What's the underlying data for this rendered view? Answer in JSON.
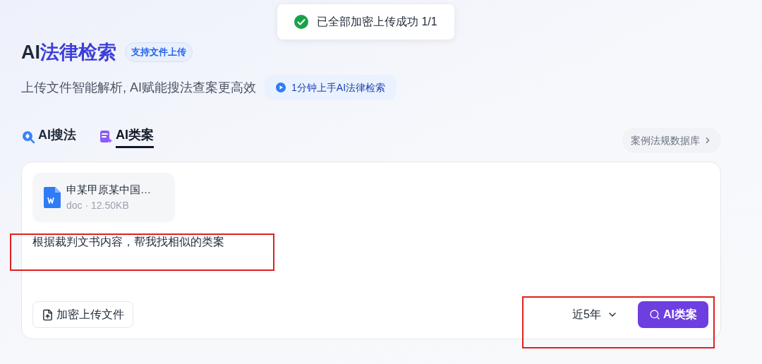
{
  "toast": {
    "text": "已全部加密上传成功 1/1"
  },
  "header": {
    "title_parts": [
      "AI",
      "法律检索"
    ],
    "badge": "支持文件上传",
    "subtitle": "上传文件智能解析, AI赋能搜法查案更高效",
    "tutorial_button": "1分钟上手AI法律检索"
  },
  "tabs": [
    {
      "label": "AI搜法",
      "kind": "search",
      "selected": false
    },
    {
      "label": "AI类案",
      "kind": "cases",
      "selected": true
    }
  ],
  "database_link": "案例法规数据库",
  "composer": {
    "attachment": {
      "name": "申某甲原某中国…",
      "meta": "doc · 12.50KB"
    },
    "prompt": {
      "text": "根据裁判文书内容，帮我找相似的类案",
      "highlighted": true
    },
    "upload_button": "加密上传文件",
    "controls": {
      "highlighted": true,
      "range": "近5年",
      "submit": "AI类案"
    }
  }
}
